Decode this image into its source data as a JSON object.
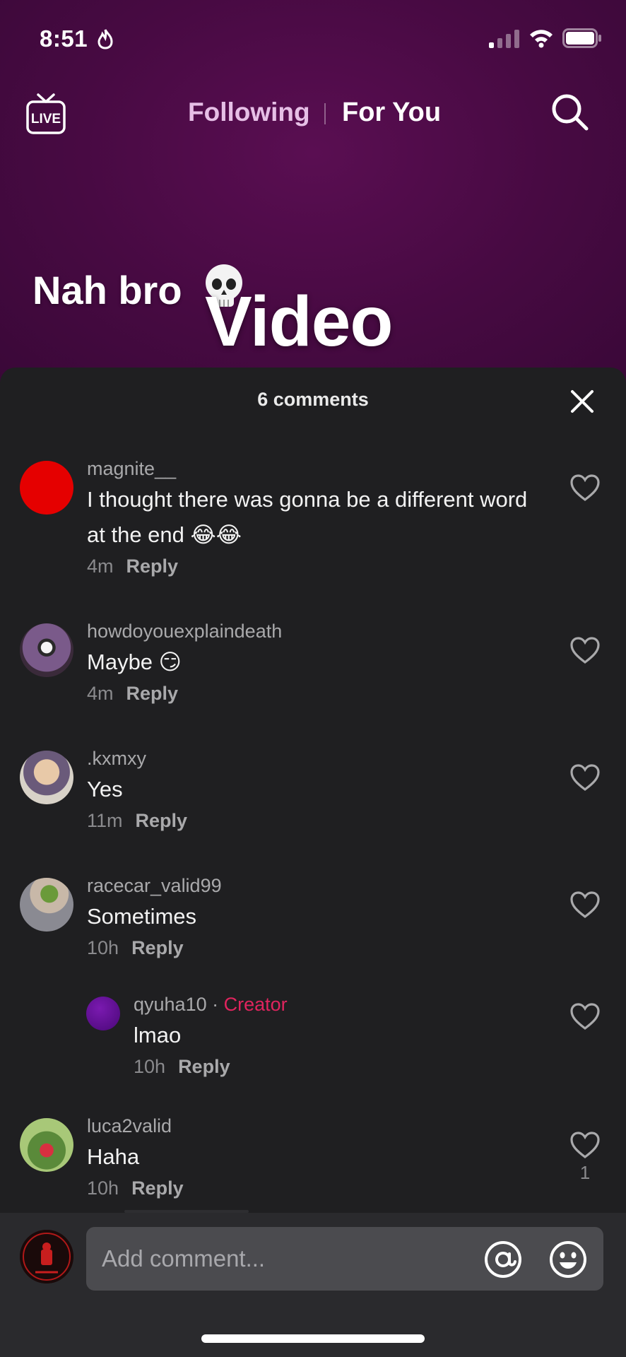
{
  "status_bar": {
    "time": "8:51"
  },
  "nav": {
    "live_label": "LIVE",
    "tab_following": "Following",
    "tab_for_you": "For You"
  },
  "video": {
    "caption": "Nah bro",
    "overlay_word": "Video"
  },
  "comments_sheet": {
    "title": "6 comments",
    "comments": [
      {
        "username": "magnite__",
        "text": "I thought there was gonna be a different word at the end 😂😂",
        "time": "4m",
        "reply": "Reply",
        "avatar_color": "#e50000"
      },
      {
        "username": "howdoyouexplaindeath",
        "text": "Maybe 😏",
        "time": "4m",
        "reply": "Reply"
      },
      {
        "username": ".kxmxy",
        "text": "Yes",
        "time": "11m",
        "reply": "Reply"
      },
      {
        "username": "racecar_valid99",
        "text": "Sometimes",
        "time": "10h",
        "reply": "Reply"
      },
      {
        "username": "qyuha10",
        "creator_label": "Creator",
        "separator": "·",
        "text": "lmao",
        "time": "10h",
        "reply": "Reply",
        "is_reply": true,
        "avatar_color": "#5a0a8c"
      },
      {
        "username": "luca2valid",
        "text": "Haha",
        "time": "10h",
        "reply": "Reply",
        "likes": "1"
      }
    ]
  },
  "composer": {
    "placeholder": "Add comment..."
  },
  "colors": {
    "accent_creator": "#e0245e",
    "sheet_bg": "#1f1f21",
    "video_bg": "#470a42"
  },
  "icons": [
    "live-icon",
    "search-icon",
    "close-icon",
    "heart-icon",
    "at-icon",
    "emoji-icon"
  ]
}
